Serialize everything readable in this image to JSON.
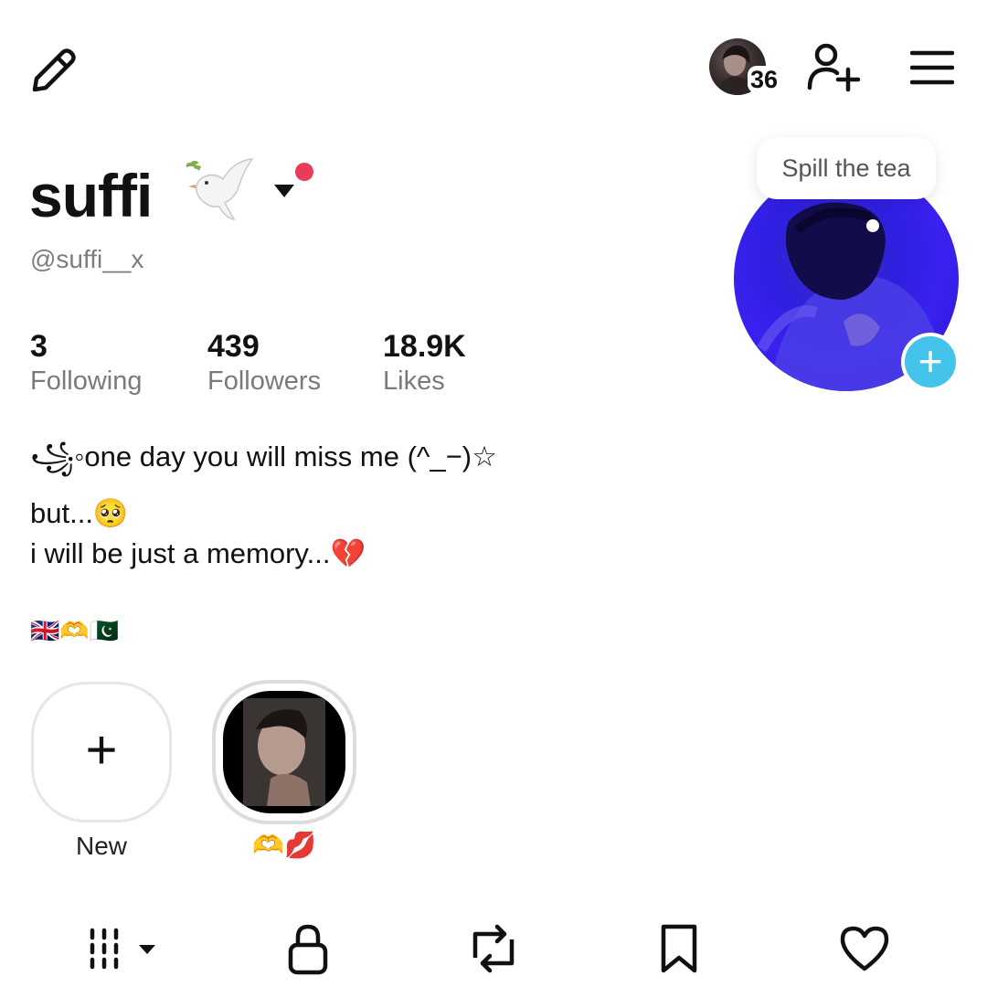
{
  "top_bar": {
    "avatar_count": "36"
  },
  "profile": {
    "name": "suffi",
    "handle": "@suffi__x"
  },
  "stats": [
    {
      "value": "3",
      "label": "Following"
    },
    {
      "value": "439",
      "label": "Followers"
    },
    {
      "value": "18.9K",
      "label": "Likes"
    }
  ],
  "bio": {
    "line1": "꧁◦one day you will miss me (^_−)☆",
    "line2": "but...🥺",
    "line3": "i will be just a memory...💔",
    "line4": "🇬🇧🫶🇵🇰"
  },
  "avatar": {
    "tooltip": "Spill the tea"
  },
  "highlights": [
    {
      "label": "New"
    },
    {
      "label": "🫶💋"
    }
  ],
  "colors": {
    "status_dot": "#ea3b5a",
    "avatar_add": "#44c3eb",
    "avatar_bg": "#3a21f0"
  },
  "icons": {
    "edit": "pencil-icon",
    "add_user": "add-user-icon",
    "menu": "hamburger-menu-icon",
    "tab_grid": "grid-icon",
    "tab_lock": "lock-icon",
    "tab_repost": "repost-icon",
    "tab_saved": "bookmark-icon",
    "tab_liked": "heart-icon"
  }
}
